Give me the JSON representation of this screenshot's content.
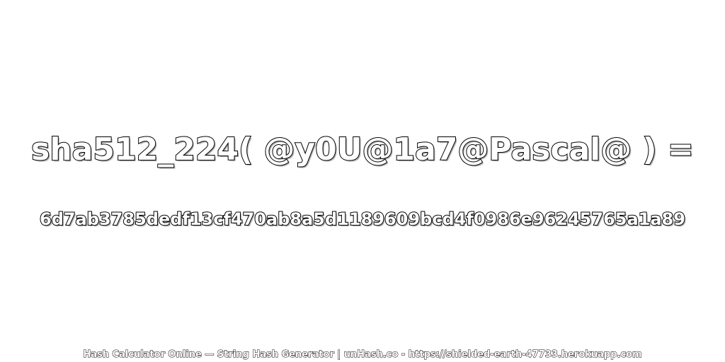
{
  "expression": "sha512_224( @y0U@1a7@Pascal@ ) =",
  "hash": "6d7ab3785dedf13cf470ab8a5d1189609bcd4f0986e96245765a1a89",
  "footer": "Hash Calculator Online — String Hash Generator | unHash.co - https://shielded-earth-47733.herokuapp.com"
}
